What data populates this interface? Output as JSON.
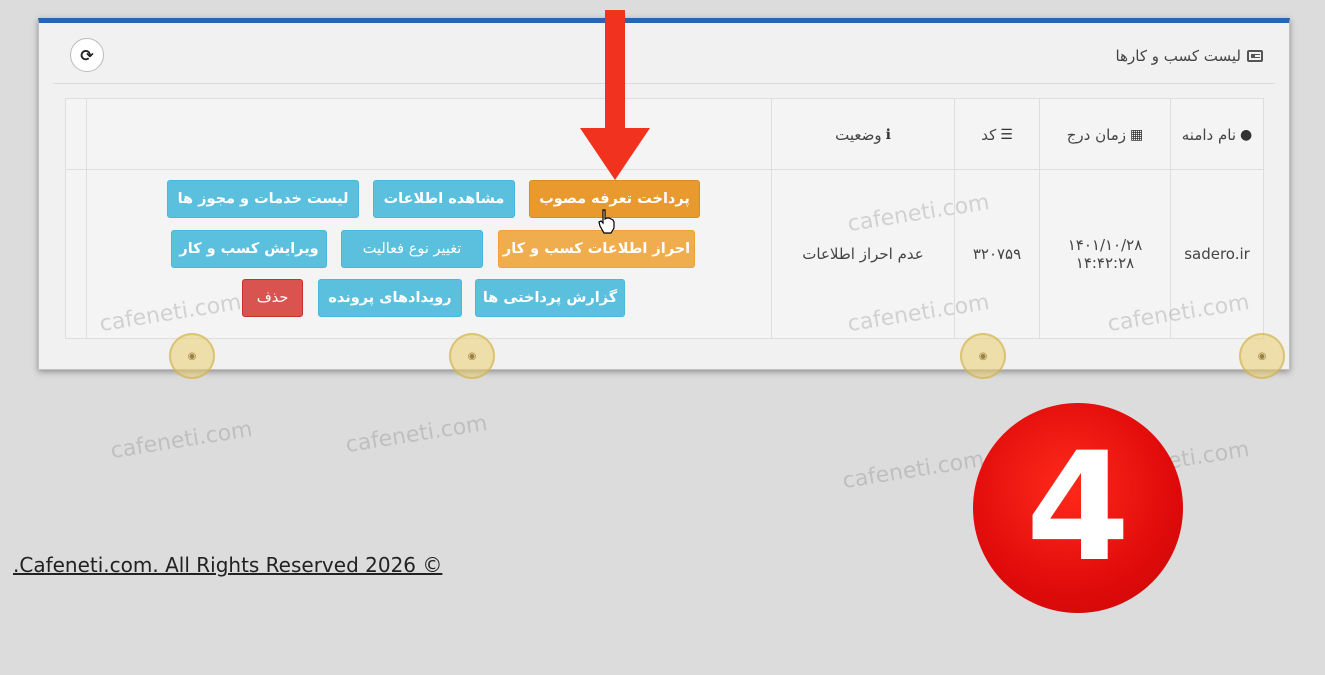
{
  "panel": {
    "title": "لیست کسب و کارها",
    "refresh_icon": "refresh-icon"
  },
  "table": {
    "headers": {
      "domain": "نام دامنه",
      "time": "زمان درج",
      "code": "کد",
      "status": "وضعیت"
    },
    "rows": [
      {
        "domain": "sadero.ir",
        "date": "۱۴۰۱/۱۰/۲۸",
        "time": "۱۴:۴۲:۲۸",
        "code": "۳۲۰۷۵۹",
        "status": "عدم احراز اطلاعات"
      }
    ]
  },
  "actions": {
    "pay_tariff": "پرداخت تعرفه مصوب",
    "view_info": "مشاهده اطلاعات",
    "services_list": "لیست خدمات و مجوز ها",
    "verify_info": "احراز اطلاعات کسب و کار",
    "change_activity": "تغییر نوع فعالیت",
    "edit_business": "ویرایش کسب و کار",
    "payments_report": "گزارش پرداختی ها",
    "file_events": "رویدادهای پرونده",
    "delete": "حذف"
  },
  "watermark": "cafeneti.com",
  "footer": ".Cafeneti.com. All Rights Reserved 2026 ©",
  "step_badge": "4",
  "colors": {
    "info": "#5bc0de",
    "warning": "#f0ad4e",
    "danger": "#d9534f",
    "header_bar": "#2a64b5",
    "badge": "#e00b0b"
  }
}
